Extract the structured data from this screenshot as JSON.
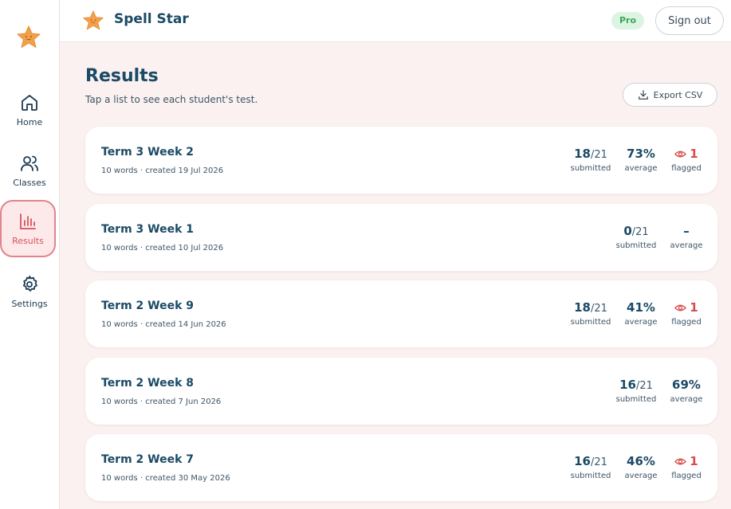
{
  "app": {
    "title": "Spell Star",
    "badge": "Pro",
    "signout_label": "Sign out"
  },
  "sidebar": {
    "items": [
      {
        "label": "Home",
        "icon": "home-icon",
        "active": false
      },
      {
        "label": "Classes",
        "icon": "users-icon",
        "active": false
      },
      {
        "label": "Results",
        "icon": "bar-chart-icon",
        "active": true
      },
      {
        "label": "Settings",
        "icon": "gear-icon",
        "active": false
      }
    ]
  },
  "page": {
    "title": "Results",
    "subtitle": "Tap a list to see each student's test.",
    "export_label": "Export CSV"
  },
  "labels": {
    "submitted": "submitted",
    "average": "average",
    "flagged": "flagged"
  },
  "lists": [
    {
      "title": "Term 3 Week 2",
      "meta": "10 words · created 19 Jul 2026",
      "submitted": "18",
      "total": "/21",
      "average": "73%",
      "flagged": "1"
    },
    {
      "title": "Term 3 Week 1",
      "meta": "10 words · created 10 Jul 2026",
      "submitted": "0",
      "total": "/21",
      "average": "–",
      "flagged": ""
    },
    {
      "title": "Term 2 Week 9",
      "meta": "10 words · created 14 Jun 2026",
      "submitted": "18",
      "total": "/21",
      "average": "41%",
      "flagged": "1"
    },
    {
      "title": "Term 2 Week 8",
      "meta": "10 words · created 7 Jun 2026",
      "submitted": "16",
      "total": "/21",
      "average": "69%",
      "flagged": ""
    },
    {
      "title": "Term 2 Week 7",
      "meta": "10 words · created 30 May 2026",
      "submitted": "16",
      "total": "/21",
      "average": "46%",
      "flagged": "1"
    }
  ],
  "colors": {
    "accent": "#1b4a66",
    "active": "#d4545c",
    "flag": "#d94b4b",
    "pro": "#3aa65a",
    "background": "#fbf1f0"
  }
}
